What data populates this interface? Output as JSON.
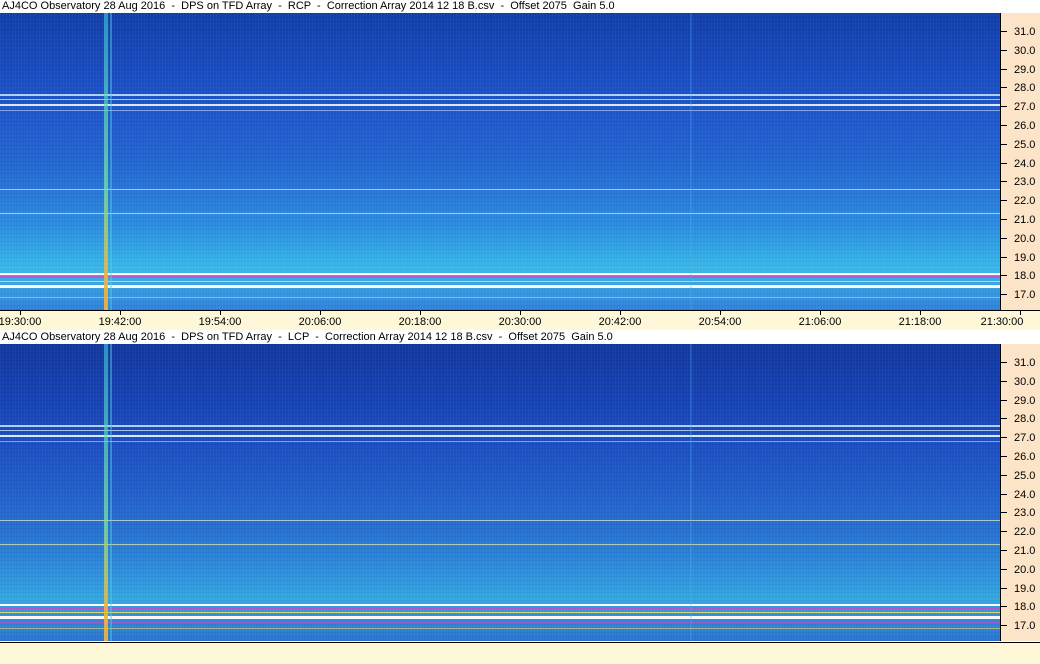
{
  "panels": [
    {
      "title": "AJ4CO Observatory 28 Aug 2016  -  DPS on TFD Array  -  RCP  -  Correction Array 2014 12 18 B.csv  -  Offset 2075  Gain 5.0",
      "polarization": "RCP"
    },
    {
      "title": "AJ4CO Observatory 28 Aug 2016  -  DPS on TFD Array  -  LCP  -  Correction Array 2014 12 18 B.csv  -  Offset 2075  Gain 5.0",
      "polarization": "LCP"
    }
  ],
  "freq_labels": [
    "31.0",
    "30.0",
    "29.0",
    "28.0",
    "27.0",
    "26.0",
    "25.0",
    "24.0",
    "23.0",
    "22.0",
    "21.0",
    "20.0",
    "19.0",
    "18.0",
    "17.0"
  ],
  "time_labels": [
    "19:30:00",
    "19:42:00",
    "19:54:00",
    "20:06:00",
    "20:18:00",
    "20:30:00",
    "20:42:00",
    "20:54:00",
    "21:06:00",
    "21:18:00",
    "21:30:00"
  ],
  "colors": {
    "axis_bg_freq": "#fce4c8",
    "axis_bg_time": "#fff8d8",
    "spectrogram_low": "#123fa8",
    "spectrogram_high": "#3cb8e8",
    "interference_bright": "#f0e060",
    "interference_magenta": "#e040c0"
  }
}
